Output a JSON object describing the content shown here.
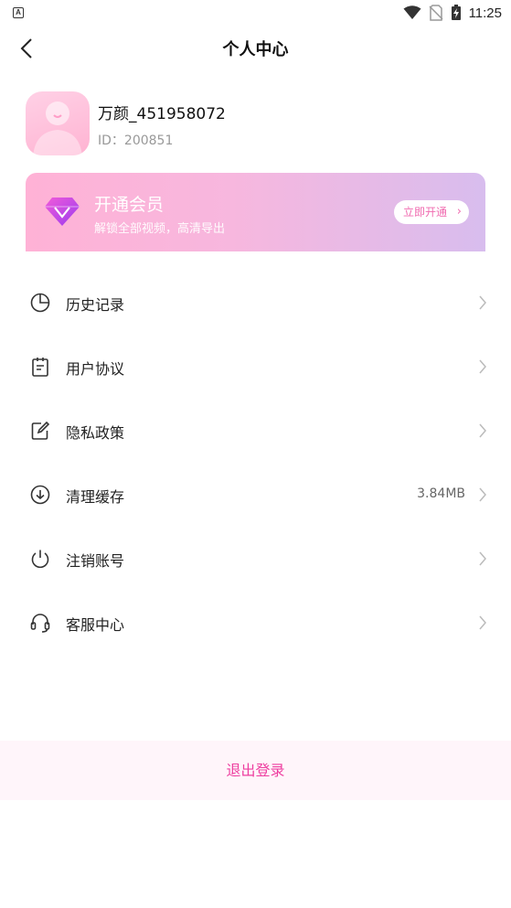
{
  "status_bar": {
    "left_icon_text": "A",
    "time": "11:25",
    "icons": [
      "wifi-icon",
      "no-sim-icon",
      "battery-charging-icon"
    ]
  },
  "header": {
    "title": "个人中心",
    "back_icon": "chevron-left-icon"
  },
  "profile": {
    "username": "万颜_451958072",
    "user_id": "ID：200851",
    "avatar_icon": "default-avatar-icon"
  },
  "vip": {
    "title": "开通会员",
    "subtitle": "解锁全部视频，高清导出",
    "button_label": "立即开通",
    "icon": "diamond-icon",
    "colors": {
      "gradient_start": "#ffb2d6",
      "gradient_end": "#d8bdee",
      "button_text": "#f06bb0"
    }
  },
  "menu": {
    "items": [
      {
        "label": "历史记录",
        "icon": "history-pie-icon",
        "value": ""
      },
      {
        "label": "用户协议",
        "icon": "agreement-document-icon",
        "value": ""
      },
      {
        "label": "隐私政策",
        "icon": "edit-note-icon",
        "value": ""
      },
      {
        "label": "清理缓存",
        "icon": "download-circle-icon",
        "value": "3.84MB"
      },
      {
        "label": "注销账号",
        "icon": "power-icon",
        "value": ""
      },
      {
        "label": "客服中心",
        "icon": "headset-icon",
        "value": ""
      }
    ]
  },
  "logout": {
    "label": "退出登录",
    "color": "#ee3fa0"
  }
}
